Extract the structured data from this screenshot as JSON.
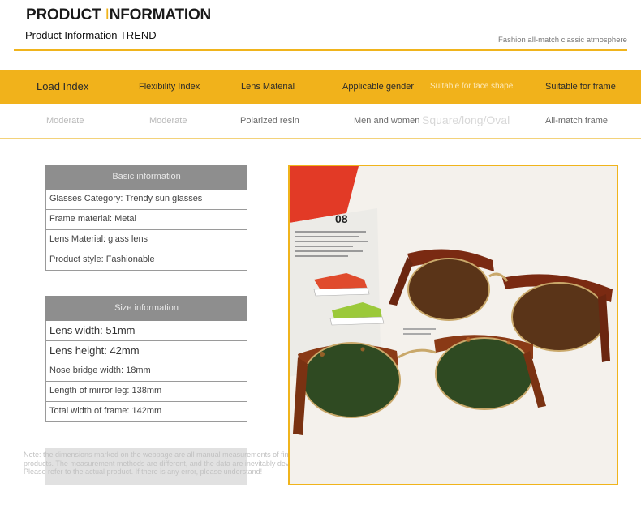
{
  "header": {
    "title_main": "PRODUCT ",
    "title_accent": "I",
    "title_rest": "NFORMATION",
    "subtitle": "Product Information TREND",
    "tagline": "Fashion all-match classic atmosphere"
  },
  "attributes": {
    "headers": [
      "Load Index",
      "Flexibility Index",
      "Lens Material",
      "Applicable gender",
      "Suitable for face shape",
      "Suitable for frame"
    ],
    "values": [
      "Moderate",
      "Moderate",
      "Polarized resin",
      "Men and women",
      "Square/long/Oval",
      "All-match frame"
    ]
  },
  "basic_info": {
    "title": "Basic information",
    "rows": [
      "Glasses Category: Trendy sun glasses",
      "Frame material: Metal",
      "Lens Material: glass lens",
      "Product style: Fashionable"
    ]
  },
  "size_info": {
    "title": "Size information",
    "rows": [
      "Lens width: 51mm",
      "Lens height: 42mm",
      "Nose bridge width: 18mm",
      "Length of mirror leg: 138mm",
      "Total width of frame: 142mm"
    ]
  },
  "note": "Note: the dimensions marked on the webpage are all manual measurements of finished products. The measurement methods are different, and the data are inevitably deviated. Please refer to the actual product. If there is any error, please understand!",
  "photo": {
    "magazine_number": "08",
    "accent_color": "#f0b41c",
    "frame_color": "#7a2a12",
    "brown_lens_color": "#5a3418",
    "green_lens_color": "#2f4a22"
  }
}
